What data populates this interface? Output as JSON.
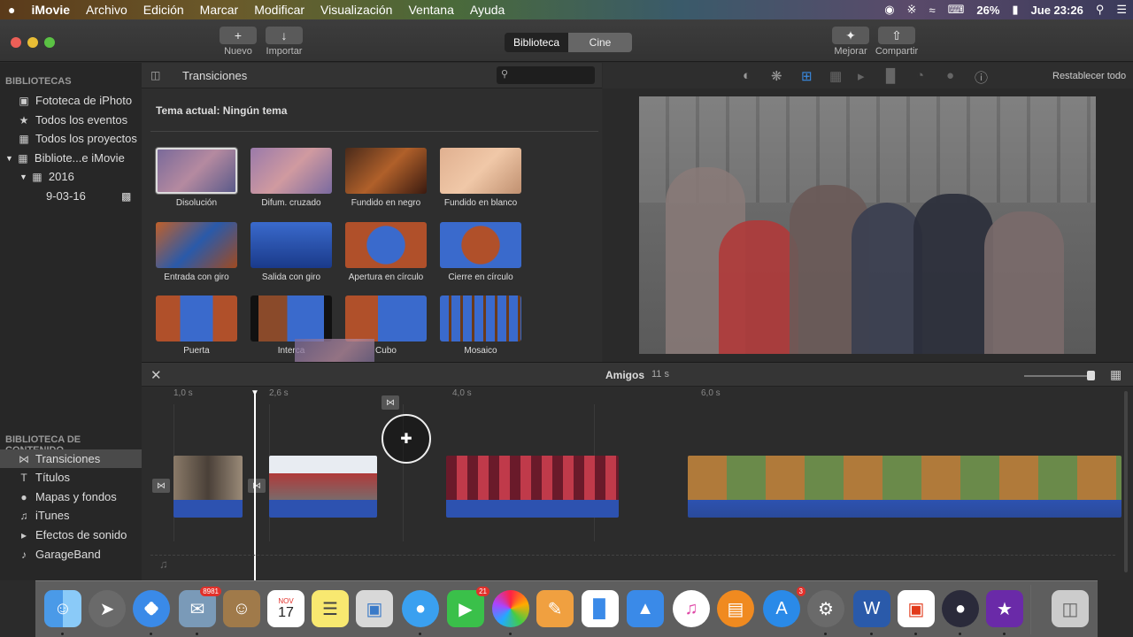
{
  "menubar": {
    "apple": "",
    "app": "iMovie",
    "items": [
      "Archivo",
      "Edición",
      "Marcar",
      "Modificar",
      "Visualización",
      "Ventana",
      "Ayuda"
    ],
    "battery": "26%",
    "clock": "Jue 23:26"
  },
  "toolbar": {
    "new_label": "Nuevo",
    "import_label": "Importar",
    "seg_library": "Biblioteca",
    "seg_cinema": "Cine",
    "enhance_label": "Mejorar",
    "share_label": "Compartir"
  },
  "sidebar": {
    "libraries_header": "BIBLIOTECAS",
    "libraries": [
      {
        "label": "Fototeca de iPhoto",
        "icon": "camera-icon"
      },
      {
        "label": "Todos los eventos",
        "icon": "star-icon"
      },
      {
        "label": "Todos los proyectos",
        "icon": "grid-icon"
      },
      {
        "label": "Bibliote...e iMovie",
        "icon": "library-icon"
      },
      {
        "label": "2016",
        "icon": "calendar-icon"
      },
      {
        "label": "9-03-16",
        "icon": "clapper-icon"
      }
    ],
    "content_header": "BIBLIOTECA DE CONTENIDO",
    "content": [
      {
        "label": "Transiciones",
        "icon": "transition-icon"
      },
      {
        "label": "Títulos",
        "icon": "title-icon"
      },
      {
        "label": "Mapas y fondos",
        "icon": "globe-icon"
      },
      {
        "label": "iTunes",
        "icon": "music-icon"
      },
      {
        "label": "Efectos de sonido",
        "icon": "speaker-icon"
      },
      {
        "label": "GarageBand",
        "icon": "guitar-icon"
      }
    ]
  },
  "browser": {
    "title": "Transiciones",
    "theme": "Tema actual: Ningún tema",
    "transitions": [
      "Disolución",
      "Difum. cruzado",
      "Fundido en negro",
      "Fundido en blanco",
      "Entrada con giro",
      "Salida con giro",
      "Apertura en círculo",
      "Cierre en círculo",
      "Puerta",
      "Interca",
      "Cubo",
      "Mosaico"
    ]
  },
  "viewer": {
    "reset_label": "Restablecer todo"
  },
  "timeline": {
    "project": "Amigos",
    "duration": "11 s",
    "marks": [
      "1,0 s",
      "2,6 s",
      "4,0 s",
      "6,0 s"
    ]
  },
  "dock": {
    "mail_badge": "8981",
    "calendar_month": "NOV",
    "calendar_day": "17",
    "facetime_badge": "21",
    "appstore_badge": "3"
  },
  "colors": {
    "accent": "#2d52b0",
    "selected_segment": "#222222",
    "playhead": "#ffffff"
  }
}
